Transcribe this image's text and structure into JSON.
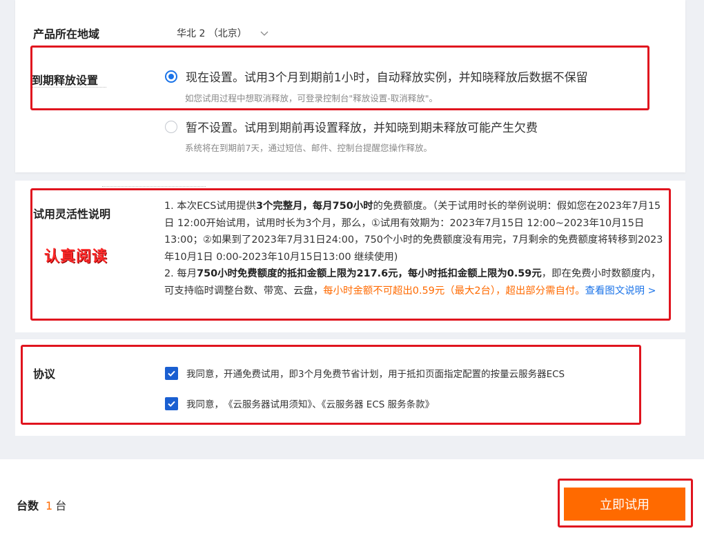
{
  "region": {
    "label": "产品所在地域",
    "value": "华北 2 （北京）"
  },
  "release": {
    "label": "到期释放设置",
    "option_now": "现在设置。试用3个月到期前1小时，自动释放实例，并知晓释放后数据不保留",
    "option_now_sub": "如您试用过程中想取消释放，可登录控制台\"释放设置-取消释放\"。",
    "option_later": "暂不设置。试用到期前再设置释放，并知晓到期未释放可能产生欠费",
    "option_later_sub": "系统将在到期前7天，通过短信、邮件、控制台提醒您操作释放。"
  },
  "trial": {
    "label": "试用灵活性说明",
    "stamp": "认真阅读",
    "p1_a": "1. 本次ECS试用提供",
    "p1_b": "3个完整月，每月750小时",
    "p1_c": "的免费额度。（关于试用时长的举例说明：假如您在2023年7月15日 12:00开始试用，试用时长为3个月，那么，①试用有效期为：2023年7月15日 12:00~2023年10月15日 13:00；②如果到了2023年7月31日24:00，750个小时的免费额度没有用完，7月剩余的免费额度将转移到2023年10月1日 0:00-2023年10月15日13:00 继续使用)",
    "p2_a": "2. 每月",
    "p2_b": "750小时免费额度的抵扣金额上限为217.6元，每小时抵扣金额上限为0.59元",
    "p2_c": "，即在免费小时数额度内，可支持临时调整台数、带宽、云盘，",
    "p2_d": "每小时金额不可超出0.59元（最大2台），超出部分需自付。",
    "p2_link": "查看图文说明 >"
  },
  "agreement": {
    "label": "协议",
    "item1": "我同意，开通免费试用，即3个月免费节省计划，用于抵扣页面指定配置的按量云服务器ECS",
    "item2_prefix": "我同意，",
    "item2_link": "《云服务器试用须知》、《云服务器 ECS 服务条款》"
  },
  "footer": {
    "qty_label": "台数",
    "qty_value": "1",
    "qty_unit": "台",
    "button": "立即试用"
  },
  "colors": {
    "accent": "#ff6a00",
    "primary": "#1a73e8",
    "highlight_box": "#e0141e"
  }
}
